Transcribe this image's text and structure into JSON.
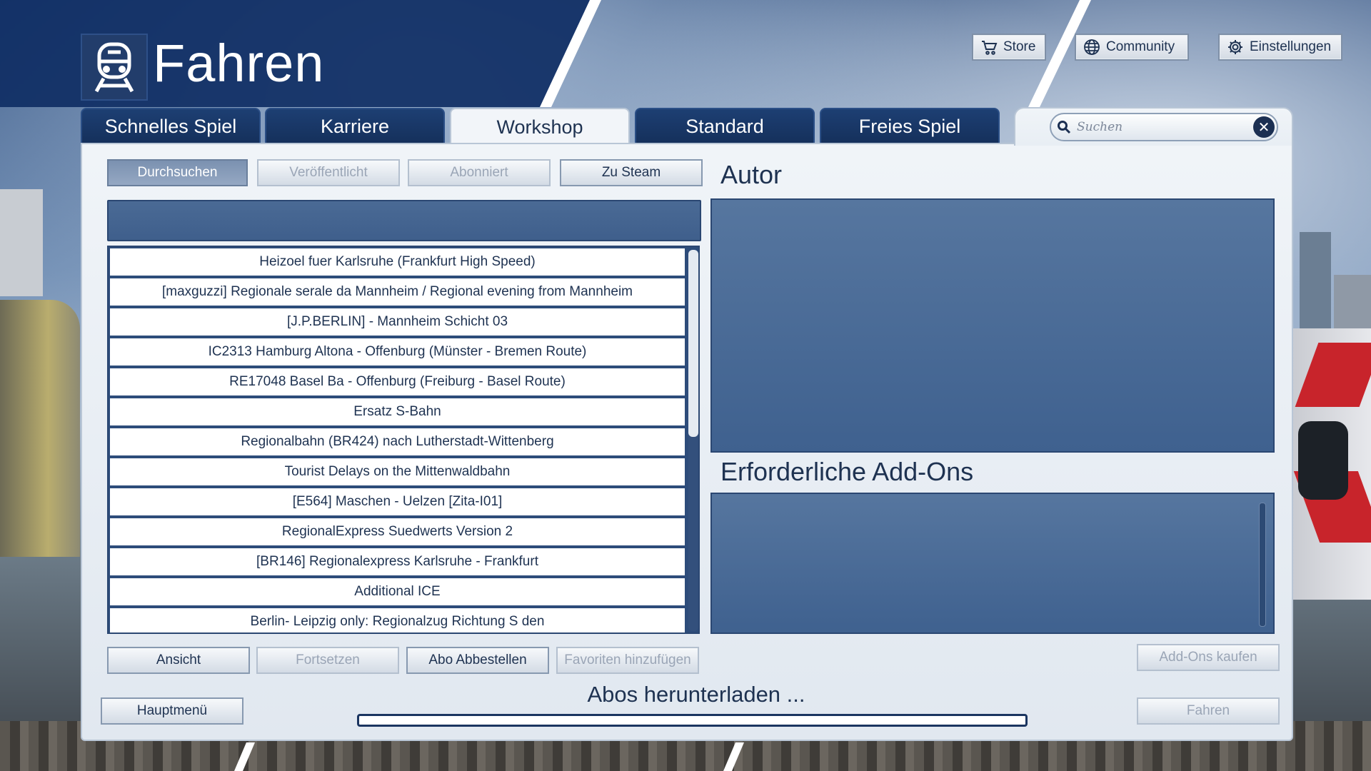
{
  "window": {
    "title": "Fahren"
  },
  "top_buttons": [
    {
      "label": "Store",
      "icon": "cart-icon"
    },
    {
      "label": "Community",
      "icon": "globe-icon"
    },
    {
      "label": "Einstellungen",
      "icon": "gear-icon"
    }
  ],
  "tabs": [
    {
      "label": "Schnelles Spiel",
      "active": false
    },
    {
      "label": "Karriere",
      "active": false
    },
    {
      "label": "Workshop",
      "active": true
    },
    {
      "label": "Standard",
      "active": false
    },
    {
      "label": "Freies Spiel",
      "active": false
    }
  ],
  "search": {
    "placeholder": "Suchen",
    "value": ""
  },
  "filter_buttons": [
    {
      "label": "Durchsuchen",
      "state": "pressed"
    },
    {
      "label": "Veröffentlicht",
      "state": "disabled"
    },
    {
      "label": "Abonniert",
      "state": "disabled"
    },
    {
      "label": "Zu Steam",
      "state": "enabled"
    }
  ],
  "workshop_list": {
    "items": [
      "Heizoel fuer Karlsruhe (Frankfurt High Speed)",
      "[maxguzzi] Regionale serale da Mannheim / Regional evening from Mannheim",
      "[J.P.BERLIN] - Mannheim Schicht 03",
      "IC2313 Hamburg Altona - Offenburg (Münster - Bremen Route)",
      "RE17048 Basel Ba - Offenburg (Freiburg - Basel Route)",
      "Ersatz S-Bahn",
      "Regionalbahn (BR424) nach Lutherstadt-Wittenberg",
      "Tourist Delays on the Mittenwaldbahn",
      "[E564] Maschen - Uelzen [Zita-I01]",
      "RegionalExpress Suedwerts Version 2",
      "[BR146] Regionalexpress Karlsruhe -  Frankfurt",
      "Additional ICE",
      "Berlin- Leipzig only: Regionalzug Richtung S  den"
    ]
  },
  "list_actions": [
    {
      "label": "Ansicht",
      "state": "enabled"
    },
    {
      "label": "Fortsetzen",
      "state": "disabled"
    },
    {
      "label": "Abo Abbestellen",
      "state": "enabled"
    },
    {
      "label": "Favoriten hinzufügen",
      "state": "disabled"
    }
  ],
  "author": {
    "title": "Autor"
  },
  "required_addons": {
    "title": "Erforderliche Add-Ons"
  },
  "buy_addons": {
    "label": "Add-Ons kaufen",
    "state": "disabled"
  },
  "main_menu": {
    "label": "Hauptmenü"
  },
  "drive": {
    "label": "Fahren",
    "state": "disabled"
  },
  "download": {
    "status": "Abos herunterladen ...",
    "progress": 0.0
  },
  "colors": {
    "accent": "#1e3251",
    "tab_bg": "#15305b",
    "panel": "#e1e8f0",
    "pane": "#4a6a95"
  }
}
